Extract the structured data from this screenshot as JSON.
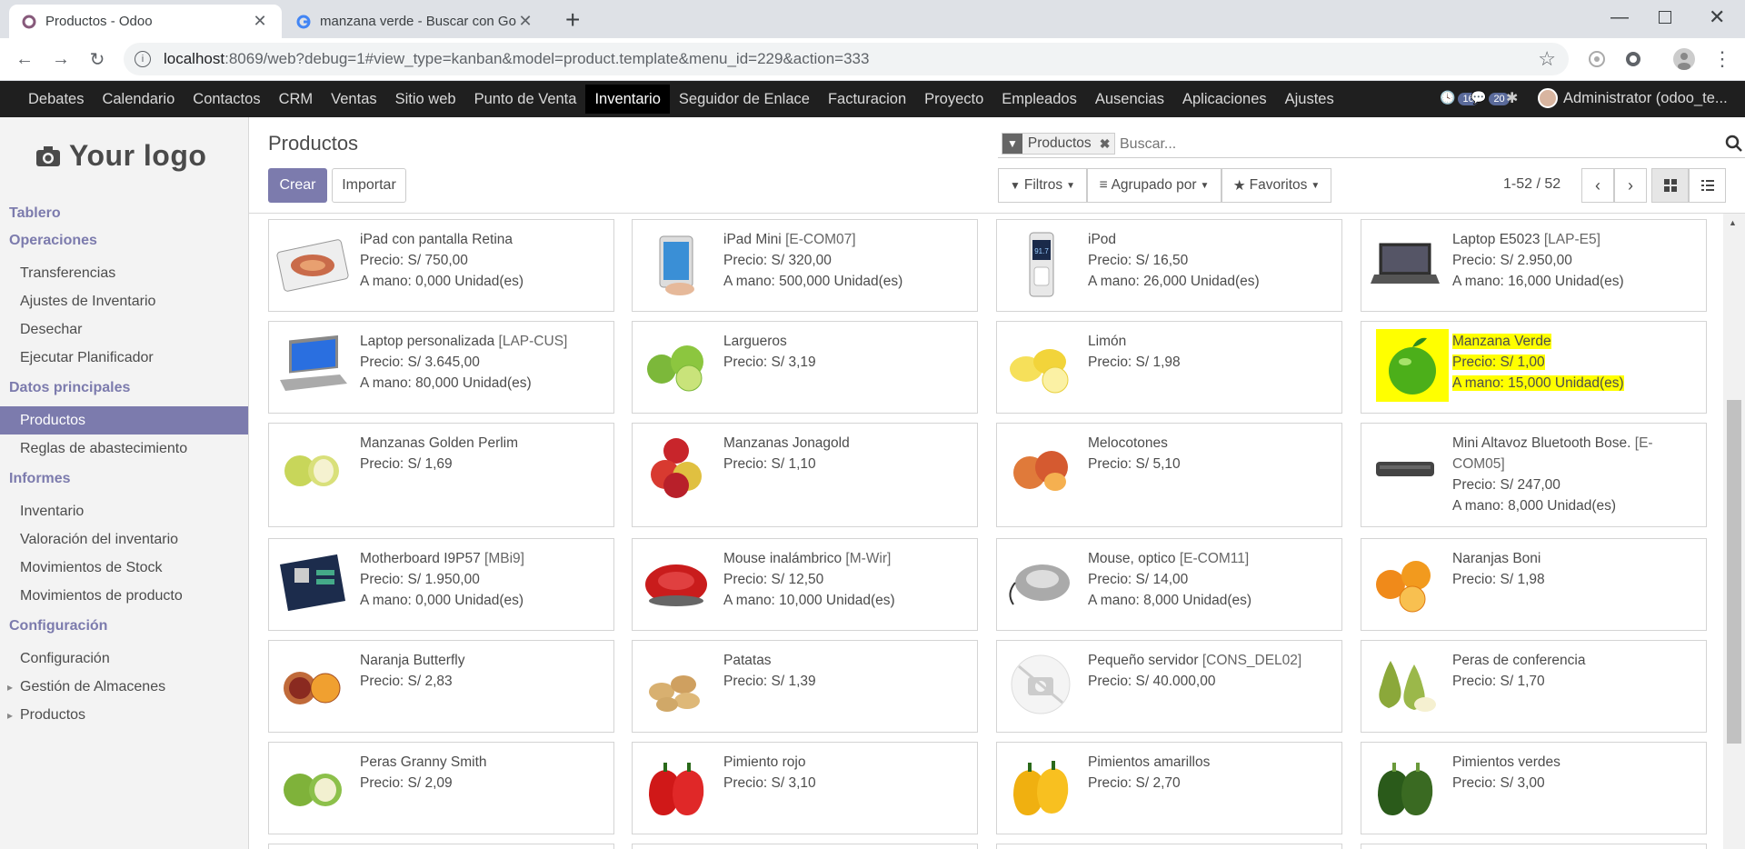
{
  "browser": {
    "tabs": [
      {
        "title": "Productos - Odoo",
        "active": true
      },
      {
        "title": "manzana verde - Buscar con Goo",
        "active": false
      }
    ],
    "new_tab": "+",
    "url_host": "localhost",
    "url_rest": ":8069/web?debug=1#view_type=kanban&model=product.template&menu_id=229&action=333"
  },
  "topmenu": {
    "items": [
      "Debates",
      "Calendario",
      "Contactos",
      "CRM",
      "Ventas",
      "Sitio web",
      "Punto de Venta",
      "Inventario",
      "Seguidor de Enlace",
      "Facturacion",
      "Proyecto",
      "Empleados",
      "Ausencias",
      "Aplicaciones",
      "Ajustes"
    ],
    "active": "Inventario",
    "activity_count": "16",
    "message_count": "20",
    "user": "Administrator (odoo_te..."
  },
  "sidebar": {
    "logo": "Your logo",
    "sections": [
      {
        "title": "Tablero",
        "items": []
      },
      {
        "title": "Operaciones",
        "items": [
          "Transferencias",
          "Ajustes de Inventario",
          "Desechar",
          "Ejecutar Planificador"
        ]
      },
      {
        "title": "Datos principales",
        "items": [
          "Productos",
          "Reglas de abastecimiento"
        ]
      },
      {
        "title": "Informes",
        "items": [
          "Inventario",
          "Valoración del inventario",
          "Movimientos de Stock",
          "Movimientos de producto"
        ]
      },
      {
        "title": "Configuración",
        "items": [
          "Configuración",
          "Gestión de Almacenes",
          "Productos"
        ]
      }
    ],
    "active_item": "Productos"
  },
  "control": {
    "breadcrumb": "Productos",
    "create": "Crear",
    "import": "Importar",
    "facet": "Productos",
    "search_placeholder": "Buscar...",
    "filters": "Filtros",
    "group_by": "Agrupado por",
    "favorites": "Favoritos",
    "pager": "1-52 / 52"
  },
  "products": [
    {
      "name": "iPad con pantalla Retina",
      "ref": "",
      "price": "Precio: S/ 750,00",
      "onhand": "A mano: 0,000 Unidad(es)",
      "icon": "tablet-food"
    },
    {
      "name": "iPad Mini",
      "ref": "[E-COM07]",
      "price": "Precio: S/ 320,00",
      "onhand": "A mano: 500,000 Unidad(es)",
      "icon": "tablet"
    },
    {
      "name": "iPod",
      "ref": "",
      "price": "Precio: S/ 16,50",
      "onhand": "A mano: 26,000 Unidad(es)",
      "icon": "ipod",
      "screen": "91.7"
    },
    {
      "name": "Laptop E5023",
      "ref": "[LAP-E5]",
      "price": "Precio: S/ 2.950,00",
      "onhand": "A mano: 16,000 Unidad(es)",
      "icon": "laptop"
    },
    {
      "name": "Laptop personalizada",
      "ref": "[LAP-CUS]",
      "price": "Precio: S/ 3.645,00",
      "onhand": "A mano: 80,000 Unidad(es)",
      "icon": "laptop-blue"
    },
    {
      "name": "Largueros",
      "ref": "",
      "price": "Precio: S/ 3,19",
      "onhand": "",
      "icon": "limes"
    },
    {
      "name": "Limón",
      "ref": "",
      "price": "Precio: S/ 1,98",
      "onhand": "",
      "icon": "lemons"
    },
    {
      "name": "Manzana Verde",
      "ref": "",
      "price": "Precio: S/ 1,00",
      "onhand": "A mano: 15,000 Unidad(es)",
      "icon": "green-apple",
      "highlight": true
    },
    {
      "name": "Manzanas Golden Perlim",
      "ref": "",
      "price": "Precio: S/ 1,69",
      "onhand": "",
      "icon": "golden-apples"
    },
    {
      "name": "Manzanas Jonagold",
      "ref": "",
      "price": "Precio: S/ 1,10",
      "onhand": "",
      "icon": "red-apples"
    },
    {
      "name": "Melocotones",
      "ref": "",
      "price": "Precio: S/ 5,10",
      "onhand": "",
      "icon": "peaches"
    },
    {
      "name": "Mini Altavoz Bluetooth Bose.",
      "ref": "[E-COM05]",
      "price": "Precio: S/ 247,00",
      "onhand": "A mano: 8,000 Unidad(es)",
      "icon": "speaker"
    },
    {
      "name": "Motherboard I9P57",
      "ref": "[MBi9]",
      "price": "Precio: S/ 1.950,00",
      "onhand": "A mano: 0,000 Unidad(es)",
      "icon": "motherboard"
    },
    {
      "name": "Mouse inalámbrico",
      "ref": "[M-Wir]",
      "price": "Precio: S/ 12,50",
      "onhand": "A mano: 10,000 Unidad(es)",
      "icon": "mouse-red"
    },
    {
      "name": "Mouse, optico",
      "ref": "[E-COM11]",
      "price": "Precio: S/ 14,00",
      "onhand": "A mano: 8,000 Unidad(es)",
      "icon": "mouse-silver"
    },
    {
      "name": "Naranjas Boni",
      "ref": "",
      "price": "Precio: S/ 1,98",
      "onhand": "",
      "icon": "oranges"
    },
    {
      "name": "Naranja Butterfly",
      "ref": "",
      "price": "Precio: S/ 2,83",
      "onhand": "",
      "icon": "blood-oranges"
    },
    {
      "name": "Patatas",
      "ref": "",
      "price": "Precio: S/ 1,39",
      "onhand": "",
      "icon": "potatoes"
    },
    {
      "name": "Pequeño servidor",
      "ref": "[CONS_DEL02]",
      "price": "Precio: S/ 40.000,00",
      "onhand": "",
      "icon": "no-image"
    },
    {
      "name": "Peras de conferencia",
      "ref": "",
      "price": "Precio: S/ 1,70",
      "onhand": "",
      "icon": "pears"
    },
    {
      "name": "Peras Granny Smith",
      "ref": "",
      "price": "Precio: S/ 2,09",
      "onhand": "",
      "icon": "granny-apples"
    },
    {
      "name": "Pimiento rojo",
      "ref": "",
      "price": "Precio: S/ 3,10",
      "onhand": "",
      "icon": "red-peppers"
    },
    {
      "name": "Pimientos amarillos",
      "ref": "",
      "price": "Precio: S/ 2,70",
      "onhand": "",
      "icon": "yellow-peppers"
    },
    {
      "name": "Pimientos verdes",
      "ref": "",
      "price": "Precio: S/ 3,00",
      "onhand": "",
      "icon": "green-peppers"
    }
  ]
}
